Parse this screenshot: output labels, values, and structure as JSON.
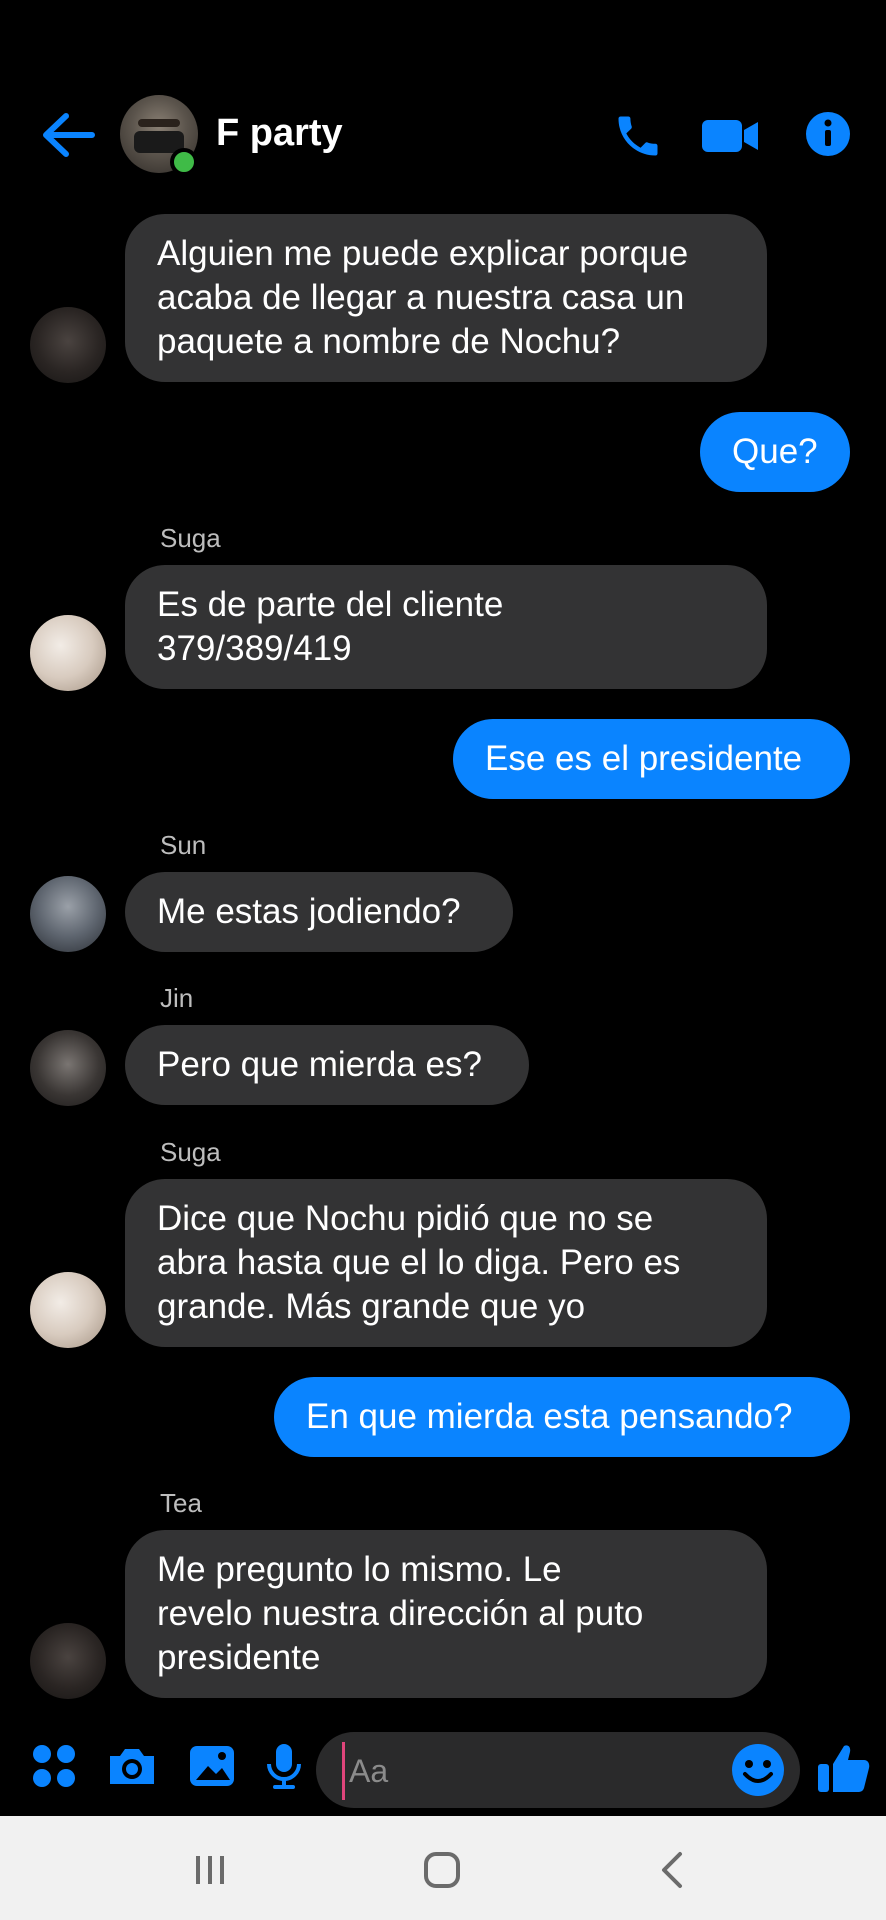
{
  "header": {
    "title": "F party"
  },
  "messages": [
    {
      "side": "in",
      "text": "Alguien me puede explicar porque\nacaba de llegar a nuestra casa un\npaquete a nombre de Nochu?"
    },
    {
      "side": "out",
      "text": "Que?"
    },
    {
      "side": "in",
      "sender": "Suga",
      "text": "Es de parte del cliente\n379/389/419"
    },
    {
      "side": "out",
      "text": "Ese es el presidente"
    },
    {
      "side": "in",
      "sender": "Sun",
      "text": "Me estas jodiendo?"
    },
    {
      "side": "in",
      "sender": "Jin",
      "text": "Pero que mierda es?"
    },
    {
      "side": "in",
      "sender": "Suga",
      "text": "Dice que Nochu pidió que no se\nabra hasta que el lo diga. Pero es\ngrande. Más grande que yo"
    },
    {
      "side": "out",
      "text": "En que mierda esta pensando?"
    },
    {
      "side": "in",
      "sender": "Tea",
      "text": "Me pregunto lo mismo. Le\nrevelo nuestra dirección al puto\npresidente"
    }
  ],
  "composer": {
    "placeholder": "Aa"
  },
  "colors": {
    "accent": "#0a84ff",
    "bubble_in": "#333334",
    "online": "#3fbb47"
  }
}
